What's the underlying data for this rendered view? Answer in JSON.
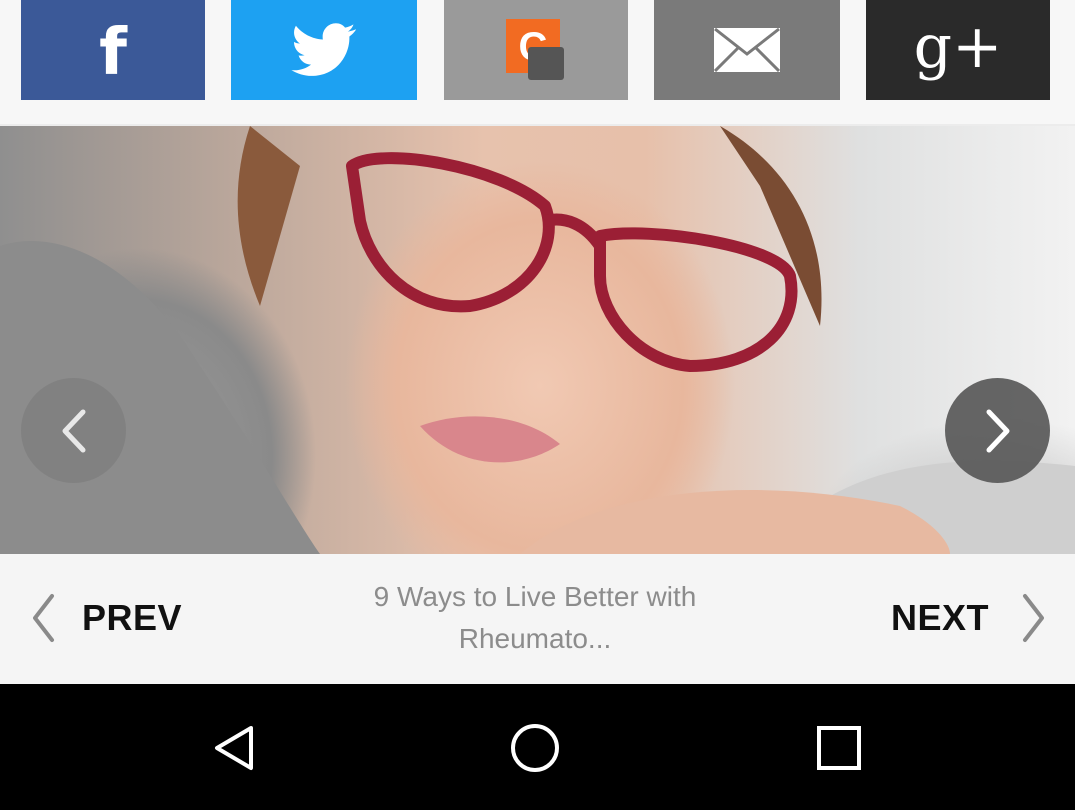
{
  "share_bar": {
    "facebook": {
      "icon": "facebook-icon",
      "glyph": "f",
      "color": "#3b5998"
    },
    "twitter": {
      "icon": "twitter-bird-icon",
      "color": "#1da1f2"
    },
    "clipboard": {
      "icon": "clipboard-c-icon",
      "glyph": "C",
      "color": "#9a9a9a",
      "accent": "#f26b22"
    },
    "email": {
      "icon": "envelope-icon",
      "color": "#7a7a7a"
    },
    "google_plus": {
      "icon": "google-plus-icon",
      "glyph": "g+",
      "color": "#2a2a2a"
    }
  },
  "hero": {
    "prev_icon": "chevron-left-icon",
    "next_icon": "chevron-right-icon"
  },
  "pager": {
    "prev_label": "PREV",
    "next_label": "NEXT",
    "title": "9 Ways to Live Better with Rheumato..."
  },
  "system_nav": {
    "back_icon": "back-triangle-icon",
    "home_icon": "home-circle-icon",
    "recents_icon": "recents-square-icon"
  }
}
